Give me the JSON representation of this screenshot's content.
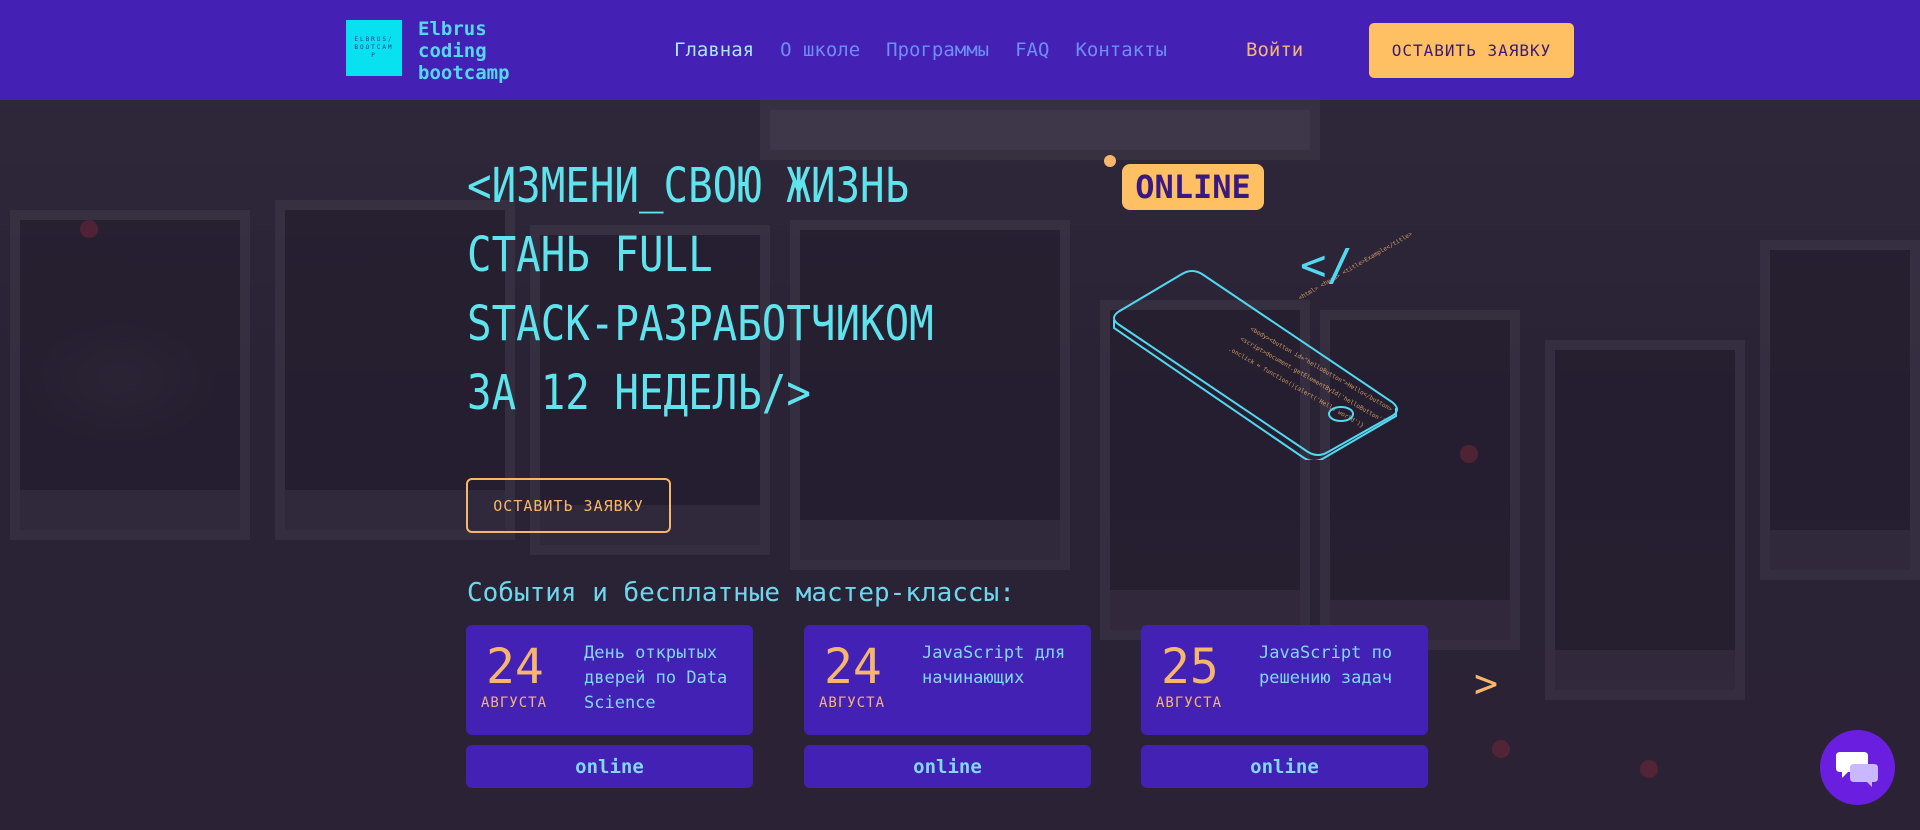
{
  "brand": {
    "logo_mark": "ELBRUS/BOOTCAMP",
    "line1": "Elbrus",
    "line2": "coding",
    "line3": "bootcamp"
  },
  "nav": {
    "items": [
      "Главная",
      "О школе",
      "Программы",
      "FAQ",
      "Контакты"
    ],
    "login": "Войти",
    "cta": "ОСТАВИТЬ ЗАЯВКУ"
  },
  "hero": {
    "line1": "<ИЗМЕНИ_СВОЮ ЖИЗНЬ",
    "line2": "СТАНЬ FULL",
    "line3": "STACK-РАЗРАБОТЧИКОМ",
    "line4": "ЗА 12 НЕДЕЛЬ/>",
    "cta": "ОСТАВИТЬ ЗАЯВКУ",
    "badge": "ONLINE",
    "code_tag": "</"
  },
  "events": {
    "title": "События и бесплатные мастер-классы:",
    "items": [
      {
        "day": "24",
        "month": "АВГУСТА",
        "title": "День открытых дверей по Data Science",
        "mode": "online"
      },
      {
        "day": "24",
        "month": "АВГУСТА",
        "title": "JavaScript для начинающих",
        "mode": "online"
      },
      {
        "day": "25",
        "month": "АВГУСТА",
        "title": "JavaScript по решению задач",
        "mode": "online"
      }
    ],
    "next": ">"
  },
  "colors": {
    "header_bg": "#4520b4",
    "accent_cyan": "#5fe4ee",
    "accent_orange": "#f6b66b",
    "card_bg": "#4321b4",
    "chat_bg": "#6a1ee0"
  }
}
